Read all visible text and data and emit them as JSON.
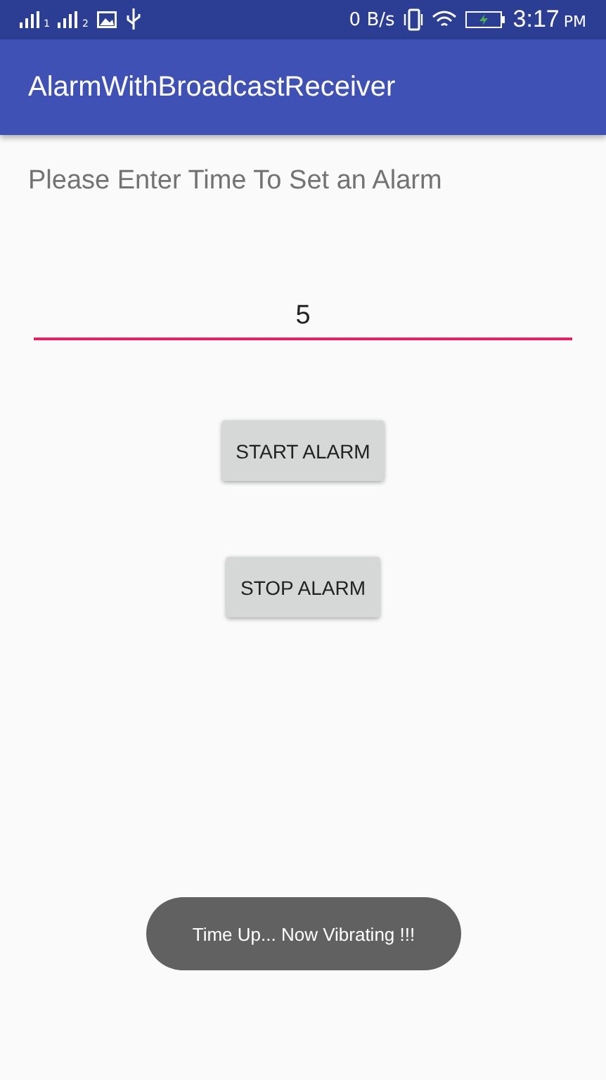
{
  "status_bar": {
    "sim_labels": [
      "1",
      "2"
    ],
    "speed": "0 B/s",
    "time": "3:17",
    "meridiem": "PM"
  },
  "app_bar": {
    "title": "AlarmWithBroadcastReceiver"
  },
  "prompt": "Please Enter Time To Set an Alarm",
  "time_field": {
    "value": "5"
  },
  "buttons": [
    "START ALARM",
    "STOP ALARM"
  ],
  "toast": "Time Up... Now Vibrating !!!"
}
